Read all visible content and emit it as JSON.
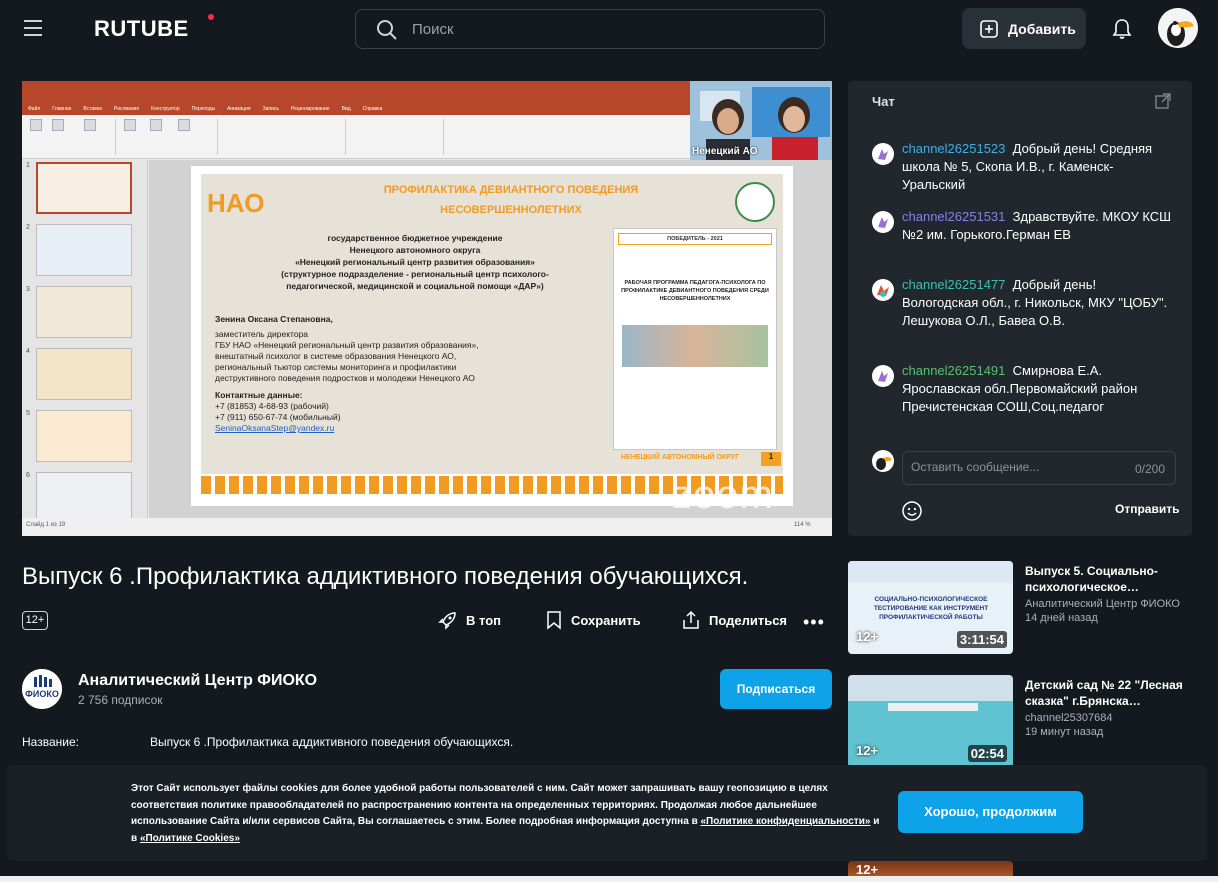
{
  "header": {
    "logo": "RUTUBE",
    "search_placeholder": "Поиск",
    "add_label": "Добавить"
  },
  "player": {
    "webcam_label": "Ненецкий АО",
    "watermark": "zoom",
    "slide": {
      "title_line1": "ПРОФИЛАКТИКА ДЕВИАНТНОГО ПОВЕДЕНИЯ",
      "title_line2": "НЕСОВЕРШЕННОЛЕТНИХ",
      "org_line1": "государственное бюджетное учреждение",
      "org_line2": "Ненецкого автономного округа",
      "org_line3": "«Ненецкий региональный центр развития образования»",
      "org_line4": "(структурное подразделение - региональный центр психолого-",
      "org_line5": "педагогической, медицинской и социальной помощи «ДАР»)",
      "person": "Зенина Оксана Степановна,",
      "role1": "заместитель директора",
      "role2": "ГБУ НАО «Ненецкий региональный центр развития образования»,",
      "role3": "внештатный психолог в системе образования Ненецкого АО,",
      "role4": "региональный тьютор системы мониторинга и профилактики",
      "role5": "деструктивного поведения подростков и молодежи Ненецкого АО",
      "contacts_title": "Контактные данные:",
      "phone1": "+7 (81853) 4-68-93 (рабочий)",
      "phone2": "+7 (911) 650-67-74 (мобильный)",
      "email": "SeninaOksanaStep@yandex.ru",
      "winner": "ПОБЕДИТЕЛЬ - 2021",
      "program_title": "РАБОЧАЯ ПРОГРАММА ПЕДАГОГА-ПСИХОЛОГА ПО ПРОФИЛАКТИКЕ ДЕВИАНТНОГО ПОВЕДЕНИЯ СРЕДИ НЕСОВЕРШЕННОЛЕТНИХ",
      "footer": "НЕНЕЦКИЙ АВТОНОМНЫЙ ОКРУГ",
      "page_num": "1"
    },
    "statusbar_left": "Слайд 1 из 19",
    "statusbar_zoom": "114 %"
  },
  "chat": {
    "title": "Чат",
    "messages": [
      {
        "user": "channel26251523",
        "color": "#3db0e8",
        "text": "Добрый день! Средняя школа № 5, Скопа И.В., г. Каменск-Уральский"
      },
      {
        "user": "channel26251531",
        "color": "#8f7dea",
        "text": "Здравствуйте. МКОУ КСШ №2 им. Горького.Герман ЕВ"
      },
      {
        "user": "channel26251477",
        "color": "#3ac0b3",
        "text": "Добрый день! Вологодская обл., г. Никольск, МКУ \"ЦОБУ\". Лешукова О.Л., Бавеа О.В."
      },
      {
        "user": "channel26251491",
        "color": "#56c271",
        "text": "Смирнова Е.А. Ярославская обл.Первомайский район Пречистенская СОШ,Соц.педагог"
      }
    ],
    "input_placeholder": "Оставить сообщение...",
    "counter": "0/200",
    "send_label": "Отправить"
  },
  "video": {
    "title": "Выпуск 6 .Профилактика аддиктивного поведения обучающихся.",
    "age": "12+",
    "actions": {
      "top": "В топ",
      "save": "Сохранить",
      "share": "Поделиться"
    }
  },
  "channel": {
    "name": "Аналитический Центр ФИОКО",
    "subscribers": "2 756 подписок",
    "subscribe_label": "Подписаться",
    "logo_text": "ФИОКО"
  },
  "meta": {
    "key": "Название:",
    "value": "Выпуск 6 .Профилактика аддиктивного поведения обучающихся."
  },
  "recommendations": [
    {
      "title": "Выпуск 5. Социально-психологическое…",
      "channel": "Аналитический Центр ФИОКО",
      "time": "14 дней назад",
      "age": "12+",
      "duration": "3:11:54",
      "thumb_text": "СОЦИАЛЬНО-ПСИХОЛОГИЧЕСКОЕ ТЕСТИРОВАНИЕ КАК ИНСТРУМЕНТ ПРОФИЛАКТИЧЕСКОЙ РАБОТЫ"
    },
    {
      "title": "Детский сад № 22 \"Лесная сказка\" г.Брянска…",
      "channel": "channel25307684",
      "time": "19 минут назад",
      "age": "12+",
      "duration": "02:54"
    },
    {
      "age": "12+"
    }
  ],
  "cookie": {
    "text": "Этот Сайт использует файлы cookies для более удобной работы пользователей с ним. Сайт может запрашивать вашу геопозицию в целях соответствия политике правообладателей по распространению контента на определенных территориях. Продолжая любое дальнейшее использование Сайта и/или сервисов Сайта, Вы соглашаетесь с этим. Более подробная информация доступна в ",
    "link1": "«Политике конфиденциальности»",
    "and": " и в ",
    "link2": "«Политике Cookies»",
    "button": "Хорошо, продолжим"
  },
  "colors": {
    "accent": "#0ea3e8",
    "bg": "#14191f",
    "panel": "#22272e",
    "logo_dot": "#ff2b4a"
  }
}
